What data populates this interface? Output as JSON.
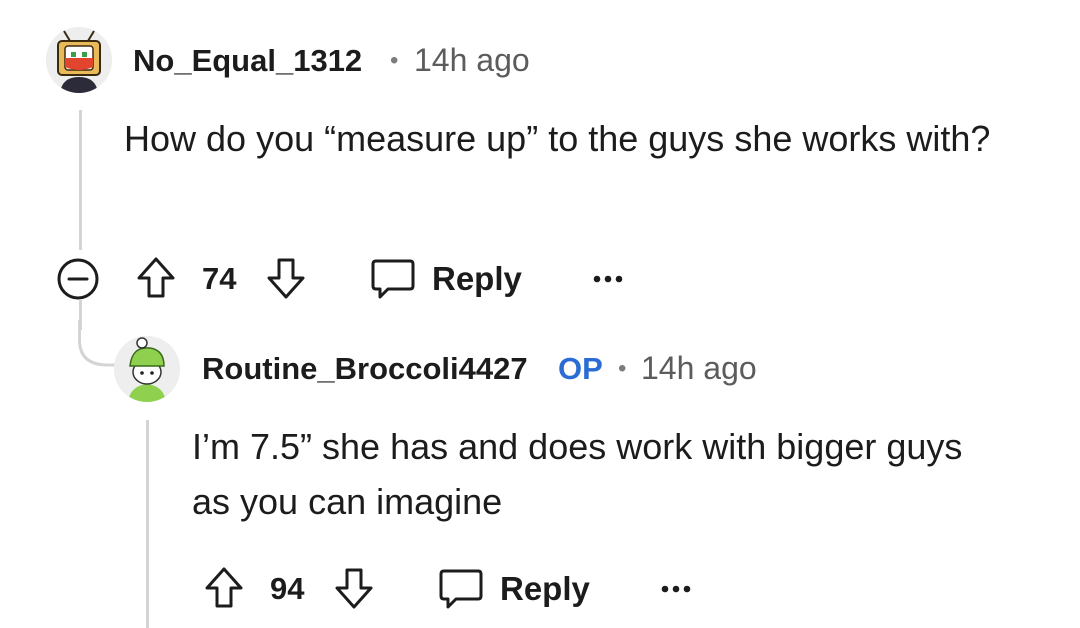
{
  "comments": [
    {
      "username": "No_Equal_1312",
      "separator": "•",
      "time": "14h ago",
      "body": "How do you “measure up” to the guys she works with?",
      "upvotes": "74",
      "reply_label": "Reply",
      "avatar_icon": "tv-snoo-avatar",
      "more_icon": "more-options-icon",
      "collapse_icon": "collapse-minus-icon"
    },
    {
      "username": "Routine_Broccoli4427",
      "op_badge": "OP",
      "separator": "•",
      "time": "14h ago",
      "body": "I’m 7.5” she has and does work with bigger guys as you can imagine",
      "upvotes": "94",
      "reply_label": "Reply",
      "avatar_icon": "green-hat-snoo-avatar",
      "more_icon": "more-options-icon"
    }
  ],
  "colors": {
    "op_badge": "#2a6bd4",
    "thread_line": "#d4d4d4",
    "text": "#1c1c1c",
    "meta": "#5c5c5c"
  }
}
